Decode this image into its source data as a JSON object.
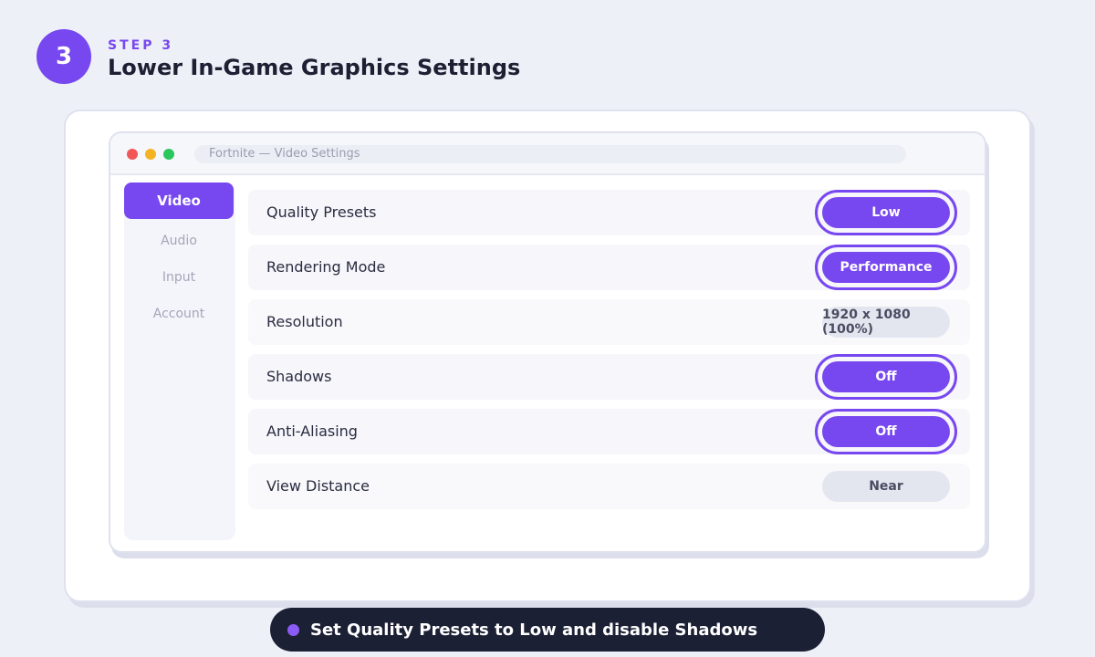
{
  "step": {
    "number": "3",
    "label": "STEP 3",
    "title": "Lower In-Game Graphics Settings"
  },
  "window": {
    "address": "Fortnite — Video Settings"
  },
  "sidebar": {
    "items": [
      {
        "label": "Video",
        "active": true
      },
      {
        "label": "Audio",
        "active": false
      },
      {
        "label": "Input",
        "active": false
      },
      {
        "label": "Account",
        "active": false
      }
    ]
  },
  "settings": [
    {
      "label": "Quality Presets",
      "value": "Low",
      "highlighted": true
    },
    {
      "label": "Rendering Mode",
      "value": "Performance",
      "highlighted": true
    },
    {
      "label": "Resolution",
      "value": "1920 x 1080 (100%)",
      "highlighted": false
    },
    {
      "label": "Shadows",
      "value": "Off",
      "highlighted": true
    },
    {
      "label": "Anti-Aliasing",
      "value": "Off",
      "highlighted": true
    },
    {
      "label": "View Distance",
      "value": "Near",
      "highlighted": false
    }
  ],
  "caption": "Set Quality Presets to Low and disable Shadows",
  "colors": {
    "accent": "#7747f0",
    "caption_bg": "#1c2035",
    "page_bg": "#eef0f8"
  }
}
